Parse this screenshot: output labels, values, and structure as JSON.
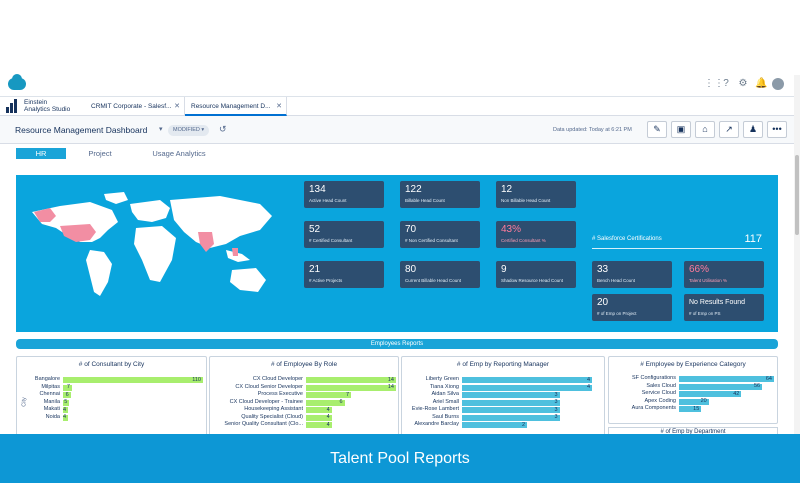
{
  "window": {
    "brand_line1": "Einstein",
    "brand_line2": "Analytics Studio",
    "tabs": [
      {
        "label": "CRMIT Corporate - Salesf..."
      },
      {
        "label": "Resource Management D..."
      }
    ]
  },
  "header": {
    "title": "Resource Management Dashboard",
    "status_badge": "MODIFIED",
    "updated": "Data updated: Today at 6:21 PM"
  },
  "page_tabs": [
    {
      "label": "HR"
    },
    {
      "label": "Project"
    },
    {
      "label": "Usage Analytics"
    }
  ],
  "kpis": [
    {
      "value": "134",
      "label": "Active Head Count"
    },
    {
      "value": "122",
      "label": "Billable Head Count"
    },
    {
      "value": "12",
      "label": "Non Billable Head Count"
    },
    {
      "value": "52",
      "label": "# Certified Consultant"
    },
    {
      "value": "70",
      "label": "# Non Certified Consultant"
    },
    {
      "value": "43%",
      "label": "Certified Consultant %"
    },
    {
      "value": "21",
      "label": "# Active Projects"
    },
    {
      "value": "80",
      "label": "Current Billable Head Count"
    },
    {
      "value": "9",
      "label": "Shadow Resource Head Count"
    },
    {
      "value": "33",
      "label": "Bench Head Count"
    },
    {
      "value": "66%",
      "label": "Talent Utilisation %"
    },
    {
      "value": "20",
      "label": "# of Emp on Project"
    },
    {
      "value": "No Results Found",
      "label": "# of Emp on PS"
    }
  ],
  "certifications": {
    "label": "# Salesforce Certifications",
    "value": "117"
  },
  "employees_reports": "Employees Reports",
  "chart_data": [
    {
      "type": "bar",
      "title": "# of Consultant by City",
      "ylabel": "City",
      "categories": [
        "Bangalore",
        "Milpitas",
        "Chennai",
        "Manila",
        "Makati",
        "Noida"
      ],
      "values": [
        110,
        7,
        6,
        5,
        4,
        4
      ]
    },
    {
      "type": "bar",
      "title": "# of Employee By Role",
      "categories": [
        "CX Cloud Developer",
        "CX Cloud Senior Developer",
        "Process Executive",
        "CX Cloud Developer - Trainee",
        "Housekeeping Assistant",
        "Quality Specialist (Cloud)",
        "Senior Quality Consultant (Clo..."
      ],
      "values": [
        14,
        14,
        7,
        6,
        4,
        4,
        4
      ]
    },
    {
      "type": "bar",
      "title": "# of Emp by Reporting Manager",
      "categories": [
        "Liberty Green",
        "Tiana Xiong",
        "Aidan Silva",
        "Ariel Small",
        "Evie-Rose Lambert",
        "Saul Burns",
        "Alexandre Barclay"
      ],
      "values": [
        4,
        4,
        3,
        3,
        3,
        3,
        2
      ]
    },
    {
      "type": "bar",
      "title": "# Employee by Experience Category",
      "categories": [
        "SF Configurations",
        "Sales Cloud",
        "Service Cloud",
        "Apex Coding",
        "Aura Components"
      ],
      "values": [
        64,
        56,
        42,
        20,
        15
      ]
    }
  ],
  "next_panel_title": "# of Emp by Department",
  "banner": "Talent Pool Reports",
  "colors": {
    "hero": "#0aa5dd",
    "kpi": "#2d4e70",
    "green_bar": "#a8ee6e",
    "blue_bar": "#4ec0de",
    "banner": "#0d97d5"
  }
}
